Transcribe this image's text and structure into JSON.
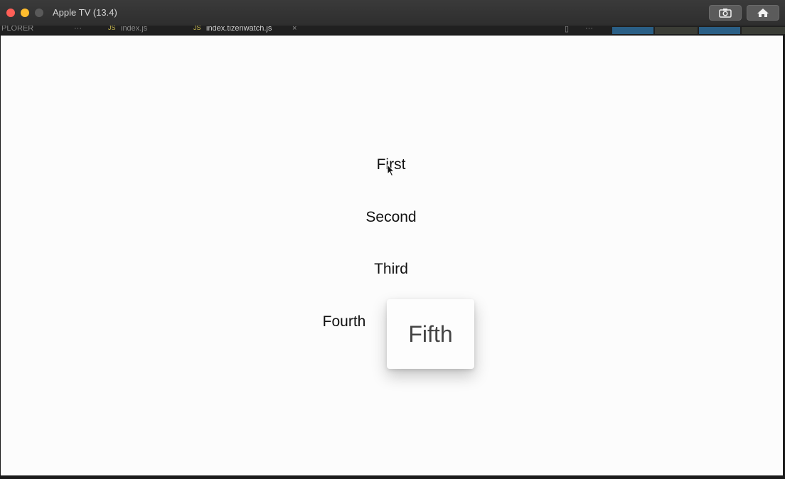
{
  "window": {
    "title": "Apple TV (13.4)",
    "buttons": [
      "screenshot-button",
      "home-button"
    ]
  },
  "background_strip": {
    "explorer": "PLORER",
    "dots1": "···",
    "tab1": "index.js",
    "tab2": "index.tizenwatch.js",
    "close": "×",
    "dots2": "···",
    "js_badge": "JS"
  },
  "screen": {
    "items": [
      "First",
      "Second",
      "Third",
      "Fourth"
    ],
    "focused_item": "Fifth"
  },
  "colors": {
    "screen_bg": "#fcfcfc",
    "titlebar": "#333333",
    "close": "#ff5f57",
    "minimize": "#febc2e",
    "maximize": "#5a5a5a"
  }
}
